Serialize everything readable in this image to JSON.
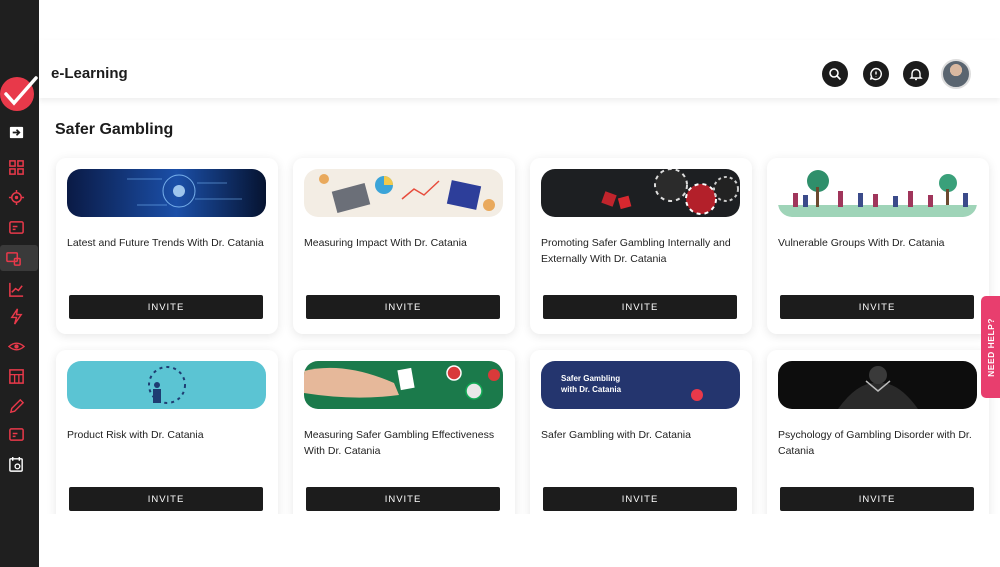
{
  "header": {
    "app_title": "e-Learning"
  },
  "section_title": "Safer Gambling",
  "courses": [
    {
      "title": "Latest and Future Trends With Dr. Catania",
      "invite": "INVITE"
    },
    {
      "title": "Measuring Impact With Dr. Catania",
      "invite": "INVITE"
    },
    {
      "title": "Promoting Safer Gambling Internally and Externally With Dr. Catania",
      "invite": "INVITE"
    },
    {
      "title": "Vulnerable Groups With Dr. Catania",
      "invite": "INVITE"
    },
    {
      "title": "Product Risk with Dr. Catania",
      "invite": "INVITE"
    },
    {
      "title": "Measuring Safer Gambling Effectiveness With Dr. Catania",
      "invite": "INVITE"
    },
    {
      "title": "Safer Gambling with Dr. Catania",
      "invite": "INVITE",
      "thumb_text": "Safer Gambling with Dr. Catania"
    },
    {
      "title": "Psychology of Gambling Disorder with Dr. Catania",
      "invite": "INVITE"
    }
  ],
  "need_help": "NEED HELP?",
  "colors": {
    "sidebar": "#1f1f1f",
    "brand_red": "#e8394a",
    "need_help": "#e83e6e",
    "button": "#1c1c1c"
  },
  "icons": {
    "header": [
      "search-icon",
      "chat-icon",
      "bell-icon"
    ],
    "sidebar": [
      "exit-icon",
      "grid-icon",
      "gear-icon",
      "card-icon",
      "monitor-icon",
      "chart-icon",
      "bolt-icon",
      "eye-icon",
      "table-icon",
      "pencil-icon",
      "card-icon",
      "calendar-gear-icon"
    ]
  }
}
